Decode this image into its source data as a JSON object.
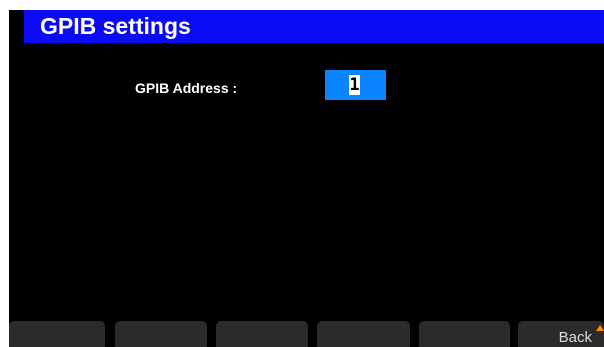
{
  "header": {
    "title": "GPIB settings"
  },
  "form": {
    "gpib_address_label": "GPIB Address :",
    "gpib_address_value": "1"
  },
  "softkeys": [
    "",
    "",
    "",
    "",
    "",
    "Back"
  ],
  "colors": {
    "title_bar": "#0a0af5",
    "field_highlight": "#0a84ff",
    "softkey_bg": "#2b2b2b",
    "back_arrow": "#ff8c00"
  },
  "icons": {
    "back": "back-arrow-icon"
  }
}
